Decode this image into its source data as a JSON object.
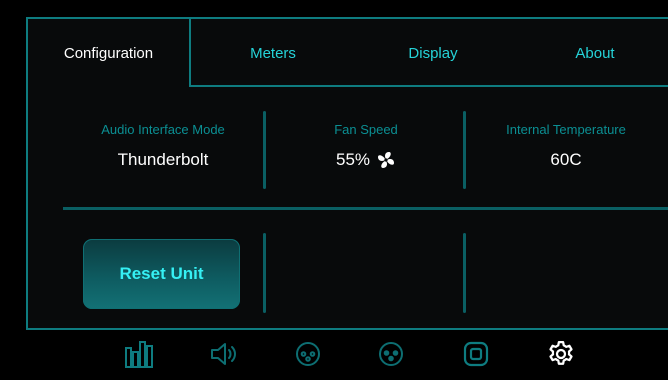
{
  "tabs": [
    {
      "label": "Configuration",
      "active": true
    },
    {
      "label": "Meters",
      "active": false
    },
    {
      "label": "Display",
      "active": false
    },
    {
      "label": "About",
      "active": false
    }
  ],
  "info": {
    "interface_mode": {
      "label": "Audio Interface Mode",
      "value": "Thunderbolt"
    },
    "fan_speed": {
      "label": "Fan Speed",
      "value": "55%"
    },
    "temperature": {
      "label": "Internal Temperature",
      "value": "60C"
    }
  },
  "actions": {
    "reset_label": "Reset Unit"
  },
  "bottom_nav": {
    "items": [
      {
        "icon": "meters-bars-icon"
      },
      {
        "icon": "speaker-icon"
      },
      {
        "icon": "xlr-input-icon"
      },
      {
        "icon": "xlr-output-icon"
      },
      {
        "icon": "device-icon"
      },
      {
        "icon": "settings-gear-icon",
        "active": true
      }
    ]
  },
  "colors": {
    "accent": "#25d3d8",
    "frame": "#0e7c80",
    "divider": "#0a5f63",
    "label": "#0b8f93",
    "inactive_icon": "#0d6e72",
    "background": "#000000"
  }
}
